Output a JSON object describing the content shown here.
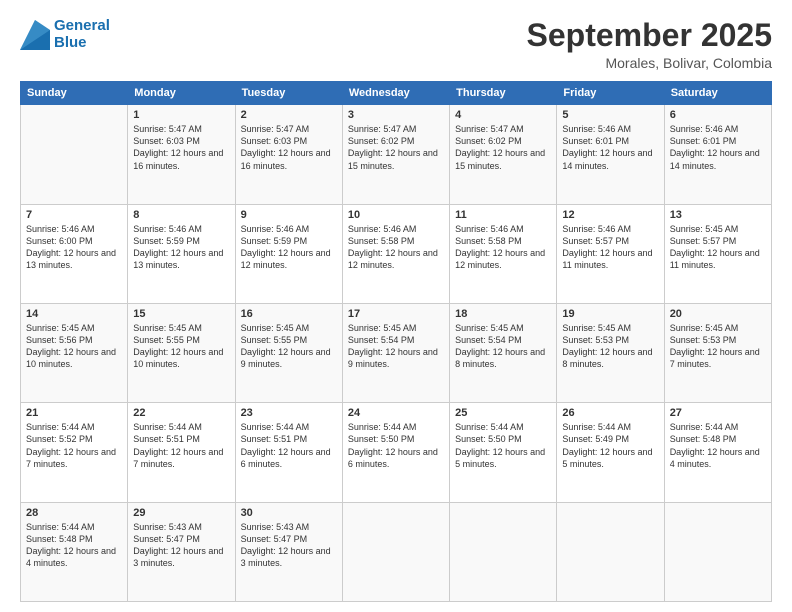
{
  "logo": {
    "line1": "General",
    "line2": "Blue"
  },
  "header": {
    "month": "September 2025",
    "location": "Morales, Bolivar, Colombia"
  },
  "weekdays": [
    "Sunday",
    "Monday",
    "Tuesday",
    "Wednesday",
    "Thursday",
    "Friday",
    "Saturday"
  ],
  "weeks": [
    [
      {
        "day": "",
        "info": ""
      },
      {
        "day": "1",
        "info": "Sunrise: 5:47 AM\nSunset: 6:03 PM\nDaylight: 12 hours\nand 16 minutes."
      },
      {
        "day": "2",
        "info": "Sunrise: 5:47 AM\nSunset: 6:03 PM\nDaylight: 12 hours\nand 16 minutes."
      },
      {
        "day": "3",
        "info": "Sunrise: 5:47 AM\nSunset: 6:02 PM\nDaylight: 12 hours\nand 15 minutes."
      },
      {
        "day": "4",
        "info": "Sunrise: 5:47 AM\nSunset: 6:02 PM\nDaylight: 12 hours\nand 15 minutes."
      },
      {
        "day": "5",
        "info": "Sunrise: 5:46 AM\nSunset: 6:01 PM\nDaylight: 12 hours\nand 14 minutes."
      },
      {
        "day": "6",
        "info": "Sunrise: 5:46 AM\nSunset: 6:01 PM\nDaylight: 12 hours\nand 14 minutes."
      }
    ],
    [
      {
        "day": "7",
        "info": "Sunrise: 5:46 AM\nSunset: 6:00 PM\nDaylight: 12 hours\nand 13 minutes."
      },
      {
        "day": "8",
        "info": "Sunrise: 5:46 AM\nSunset: 5:59 PM\nDaylight: 12 hours\nand 13 minutes."
      },
      {
        "day": "9",
        "info": "Sunrise: 5:46 AM\nSunset: 5:59 PM\nDaylight: 12 hours\nand 12 minutes."
      },
      {
        "day": "10",
        "info": "Sunrise: 5:46 AM\nSunset: 5:58 PM\nDaylight: 12 hours\nand 12 minutes."
      },
      {
        "day": "11",
        "info": "Sunrise: 5:46 AM\nSunset: 5:58 PM\nDaylight: 12 hours\nand 12 minutes."
      },
      {
        "day": "12",
        "info": "Sunrise: 5:46 AM\nSunset: 5:57 PM\nDaylight: 12 hours\nand 11 minutes."
      },
      {
        "day": "13",
        "info": "Sunrise: 5:45 AM\nSunset: 5:57 PM\nDaylight: 12 hours\nand 11 minutes."
      }
    ],
    [
      {
        "day": "14",
        "info": "Sunrise: 5:45 AM\nSunset: 5:56 PM\nDaylight: 12 hours\nand 10 minutes."
      },
      {
        "day": "15",
        "info": "Sunrise: 5:45 AM\nSunset: 5:55 PM\nDaylight: 12 hours\nand 10 minutes."
      },
      {
        "day": "16",
        "info": "Sunrise: 5:45 AM\nSunset: 5:55 PM\nDaylight: 12 hours\nand 9 minutes."
      },
      {
        "day": "17",
        "info": "Sunrise: 5:45 AM\nSunset: 5:54 PM\nDaylight: 12 hours\nand 9 minutes."
      },
      {
        "day": "18",
        "info": "Sunrise: 5:45 AM\nSunset: 5:54 PM\nDaylight: 12 hours\nand 8 minutes."
      },
      {
        "day": "19",
        "info": "Sunrise: 5:45 AM\nSunset: 5:53 PM\nDaylight: 12 hours\nand 8 minutes."
      },
      {
        "day": "20",
        "info": "Sunrise: 5:45 AM\nSunset: 5:53 PM\nDaylight: 12 hours\nand 7 minutes."
      }
    ],
    [
      {
        "day": "21",
        "info": "Sunrise: 5:44 AM\nSunset: 5:52 PM\nDaylight: 12 hours\nand 7 minutes."
      },
      {
        "day": "22",
        "info": "Sunrise: 5:44 AM\nSunset: 5:51 PM\nDaylight: 12 hours\nand 7 minutes."
      },
      {
        "day": "23",
        "info": "Sunrise: 5:44 AM\nSunset: 5:51 PM\nDaylight: 12 hours\nand 6 minutes."
      },
      {
        "day": "24",
        "info": "Sunrise: 5:44 AM\nSunset: 5:50 PM\nDaylight: 12 hours\nand 6 minutes."
      },
      {
        "day": "25",
        "info": "Sunrise: 5:44 AM\nSunset: 5:50 PM\nDaylight: 12 hours\nand 5 minutes."
      },
      {
        "day": "26",
        "info": "Sunrise: 5:44 AM\nSunset: 5:49 PM\nDaylight: 12 hours\nand 5 minutes."
      },
      {
        "day": "27",
        "info": "Sunrise: 5:44 AM\nSunset: 5:48 PM\nDaylight: 12 hours\nand 4 minutes."
      }
    ],
    [
      {
        "day": "28",
        "info": "Sunrise: 5:44 AM\nSunset: 5:48 PM\nDaylight: 12 hours\nand 4 minutes."
      },
      {
        "day": "29",
        "info": "Sunrise: 5:43 AM\nSunset: 5:47 PM\nDaylight: 12 hours\nand 3 minutes."
      },
      {
        "day": "30",
        "info": "Sunrise: 5:43 AM\nSunset: 5:47 PM\nDaylight: 12 hours\nand 3 minutes."
      },
      {
        "day": "",
        "info": ""
      },
      {
        "day": "",
        "info": ""
      },
      {
        "day": "",
        "info": ""
      },
      {
        "day": "",
        "info": ""
      }
    ]
  ]
}
